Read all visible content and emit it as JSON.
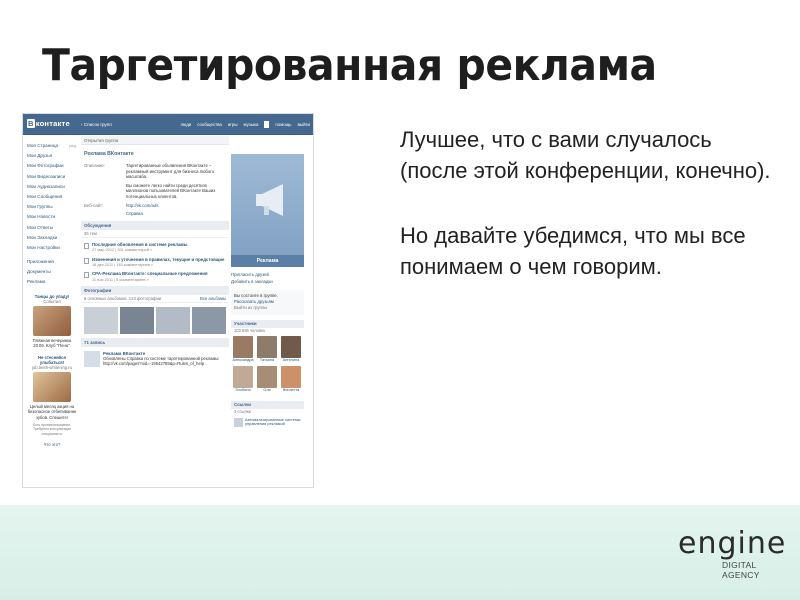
{
  "slide": {
    "title": "Таргетированная реклама",
    "paragraph1": "Лучшее, что с вами случалось (после этой конференции, конечно).",
    "paragraph2": "Но давайте убедимся, что мы все понимаем о чем говорим.",
    "logo_word": "engine",
    "logo_sub": "DIGITAL AGENCY",
    "footer_color": "#dcefe9"
  },
  "vk": {
    "logo": "контакте",
    "logo_letter": "В",
    "back_link": "‹ Список групп",
    "nav": [
      "люди",
      "сообщества",
      "игры",
      "музыка",
      "помощь",
      "выйти"
    ],
    "menu": [
      "Моя Страница",
      "Мои Друзья",
      "Мои Фотографии",
      "Мои Видеозаписи",
      "Мои Аудиозаписи",
      "Мои Сообщения",
      "Мои Группы",
      "Мои Новости",
      "Мои Ответы",
      "Мои Закладки",
      "Мои Настройки"
    ],
    "menu_edit": "ред.",
    "menu2": [
      "Приложения",
      "Документы",
      "Реклама"
    ],
    "ad1": {
      "title": "Танцы до упаду!",
      "sub": "События",
      "text": "Пляжная вечеринка 20.06. Клуб \"Пена\".",
      "colors": [
        "#caa27e",
        "#8f5d3d"
      ]
    },
    "ad2": {
      "title": "Не стесняйся улыбаться!",
      "sub": "job.teeth-whitening.ru",
      "text": "Целый месяц акция на безопасное отбеливание зубов. Спешите!",
      "note": "Есть противопоказания. Требуется консультация специалиста.",
      "colors": [
        "#e2c39a",
        "#9b6b45"
      ]
    },
    "ads_more": "Что это?",
    "main": {
      "breadcrumb": "Открытая группа",
      "group_name": "Реклама ВКонтакте",
      "description_label": "Описание:",
      "description": "Таргетированные объявления ВКонтакте – рекламный инструмент для бизнеса любого масштаба.",
      "description2": "Вы сможете легко найти среди десятков миллионов пользователей ВКонтакте Ваших потенциальных клиентов.",
      "website_label": "Веб-сайт:",
      "website": "http://vk.com/ads",
      "help_link": "Справка",
      "discussions_title": "Обсуждения",
      "discussions_sub": "36 тем",
      "topics": [
        {
          "title": "Последние обновления в системе рекламы",
          "meta": "27 мар 2012 | 391 комментарий »"
        },
        {
          "title": "Изменения и уточнения в правилах, текущие и предстоящие",
          "meta": "16 дек 2011 | 145 комментариев »"
        },
        {
          "title": "CPA-Реклама ВКонтакте: специальные предложения",
          "meta": "11 ноя 2011 | 5 комментариев »"
        }
      ],
      "photos_title": "Фотографии",
      "photos_sub": "8 основных альбомов. 123 фотографии",
      "photos_all": "Все альбомы",
      "photo_colors": [
        "#c9cfd6",
        "#7a8593",
        "#b3bcc6",
        "#8c98a6"
      ],
      "wall_title": "71 запись",
      "post_title": "Реклама ВКонтакте",
      "post_text": "Обновлены Справка по системе таргетированной рекламы: http://vk.com/pages?oid=-19542789&p=Rules_of_help"
    },
    "right": {
      "poster_caption": "Реклама",
      "invite": "Пригласить друзей",
      "bookmark": "Добавить в закладки",
      "status_text": "Вы состоите в группе.",
      "tell_friends": "Рассказать друзьям",
      "leave": "Выйти из группы",
      "members_title": "Участники",
      "members_sub": "103 936 человек",
      "members": [
        {
          "name": "Александра",
          "color": "#9a7a62"
        },
        {
          "name": "Татьяна",
          "color": "#8d7b6b"
        },
        {
          "name": "Ангелина",
          "color": "#6f5a4c"
        },
        {
          "name": "Злобина",
          "color": "#c0a995"
        },
        {
          "name": "Оля",
          "color": "#a88d76"
        },
        {
          "name": "Виолетта",
          "color": "#cc9168"
        }
      ],
      "links_title": "Ссылки",
      "links_sub": "3 ссылки",
      "link_item": "Автоматизированные системы управления рекламой"
    }
  }
}
